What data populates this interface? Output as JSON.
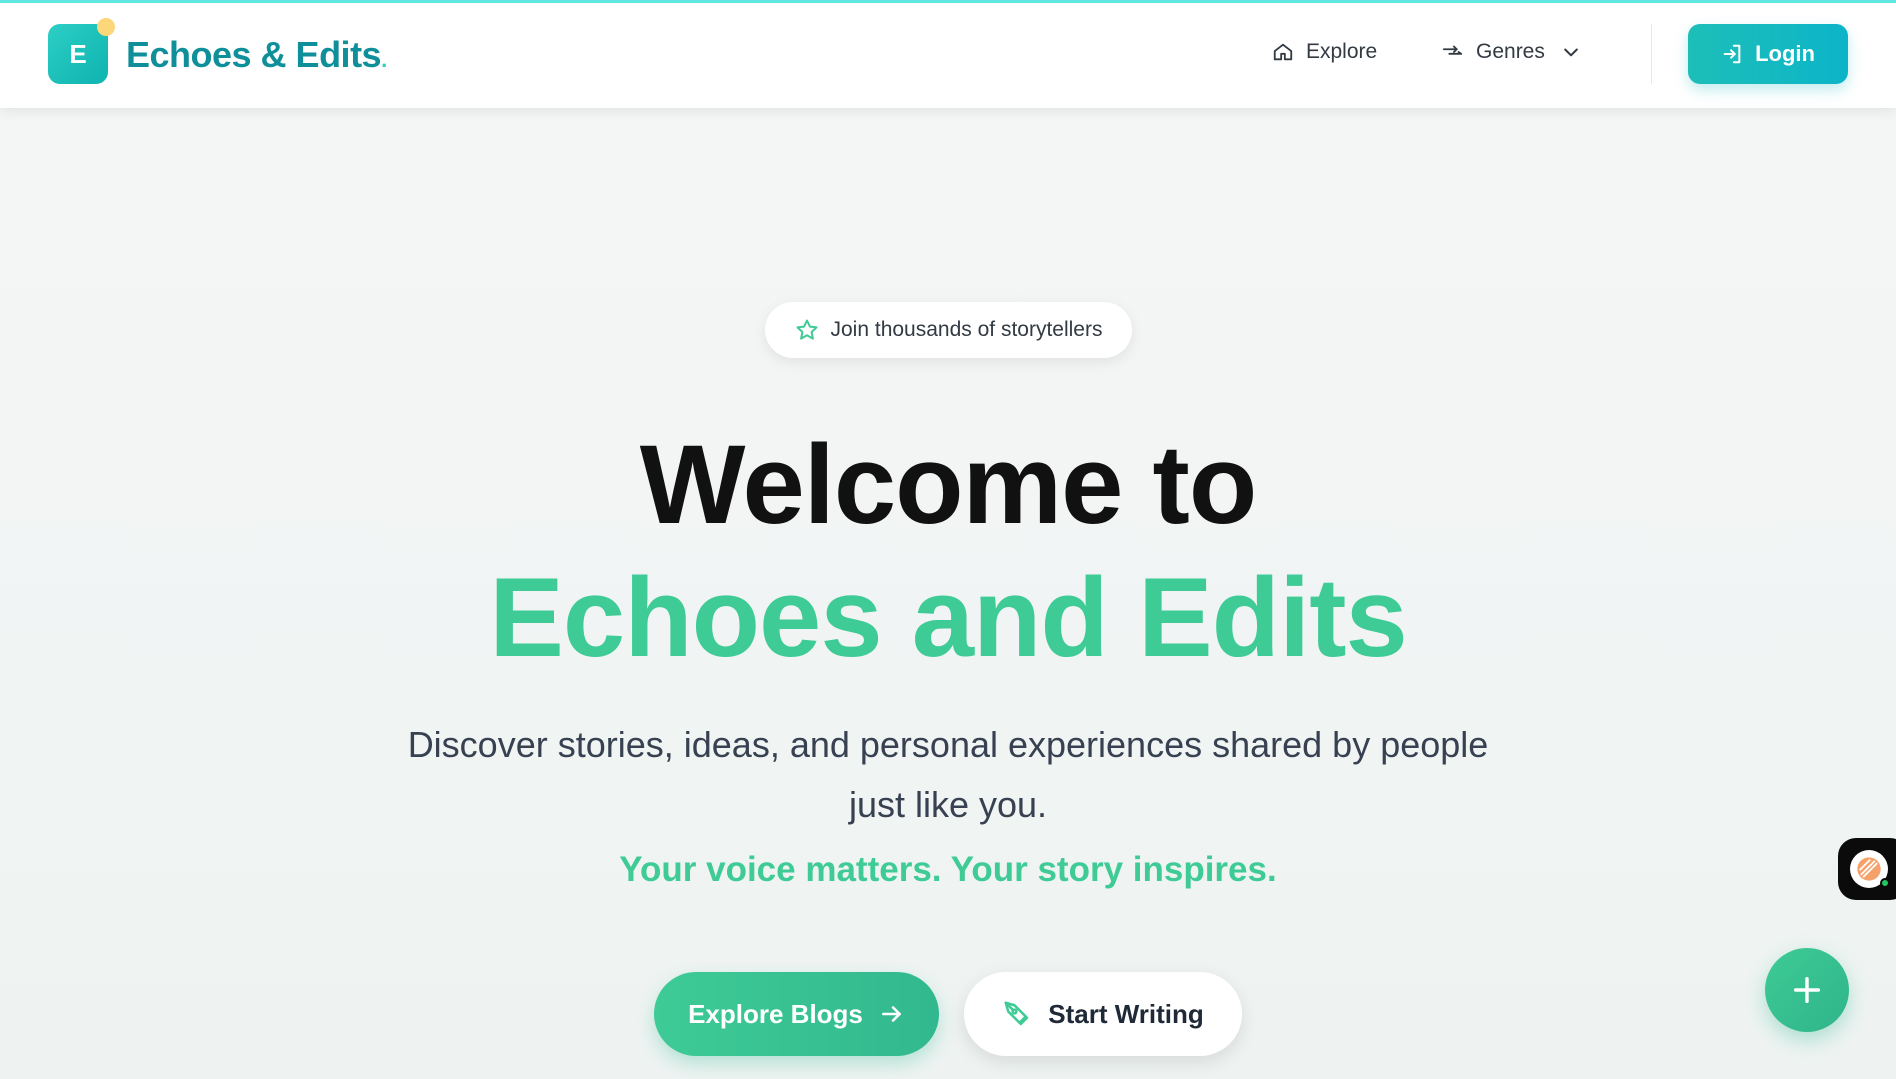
{
  "navbar": {
    "logo_letter": "E",
    "brand_name": "Echoes & Edits",
    "brand_suffix": ".",
    "explore_label": "Explore",
    "genres_label": "Genres",
    "login_label": "Login"
  },
  "hero": {
    "badge_label": "Join thousands of storytellers",
    "title_line1": "Welcome to",
    "title_line2": "Echoes and Edits",
    "subtitle": "Discover stories, ideas, and personal experiences shared by people just like you.",
    "tagline": "Your voice matters. Your story inspires.",
    "explore_button": "Explore Blogs",
    "write_button": "Start Writing"
  },
  "colors": {
    "brand_teal": "#0f8f9a",
    "accent_green": "#3ecb96",
    "login_gradient_start": "#1dbfb8",
    "login_gradient_end": "#0cb4c8"
  },
  "icons": {
    "explore": "home-icon",
    "genres": "genres-icon",
    "genres_dropdown": "chevron-down-icon",
    "login": "login-icon",
    "badge": "star-icon",
    "explore_button": "arrow-right-icon",
    "write_button": "pen-icon",
    "fab": "plus-icon",
    "side_widget": "chat-widget-icon"
  }
}
